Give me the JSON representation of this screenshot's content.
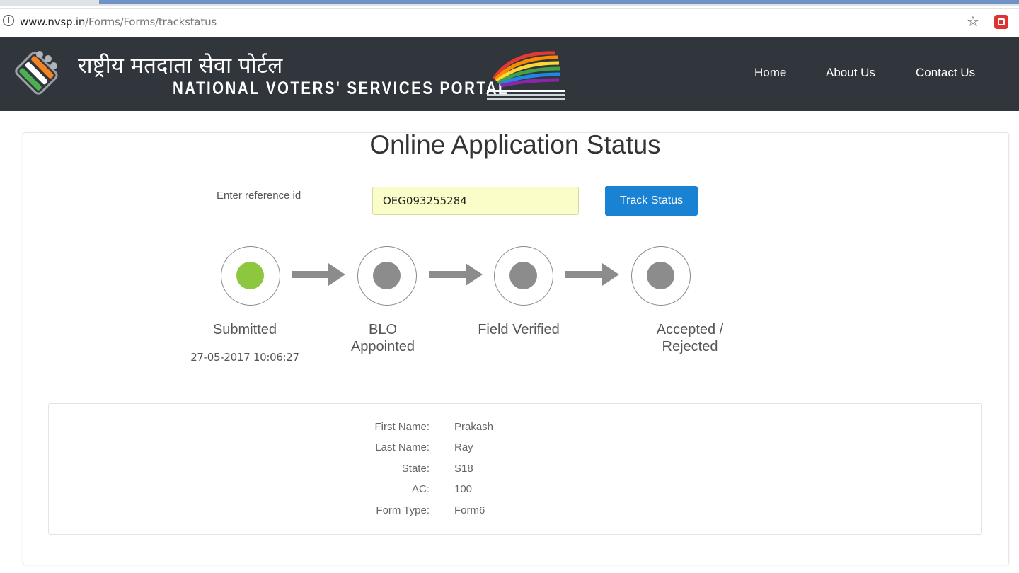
{
  "browser": {
    "url_host": "www.nvsp.in",
    "url_path": "/Forms/Forms/trackstatus"
  },
  "header": {
    "hindi_title": "राष्ट्रीय मतदाता सेवा पोर्टल",
    "english_title": "NATIONAL VOTERS' SERVICES PORTAL",
    "nav": [
      {
        "label": "Home"
      },
      {
        "label": "About Us"
      },
      {
        "label": "Contact Us"
      }
    ]
  },
  "main": {
    "title": "Online Application Status",
    "ref_label": "Enter reference id",
    "ref_value": "OEG093255284",
    "track_button": "Track Status"
  },
  "steps": [
    {
      "label_line1": "Submitted",
      "label_line2": "",
      "date": "27-05-2017 10:06:27",
      "active": true
    },
    {
      "label_line1": "BLO",
      "label_line2": "Appointed",
      "active": false
    },
    {
      "label_line1": "Field Verified",
      "label_line2": "",
      "active": false
    },
    {
      "label_line1": "Accepted /",
      "label_line2": "Rejected",
      "active": false
    }
  ],
  "details": [
    {
      "label": "First Name:",
      "value": "Prakash"
    },
    {
      "label": "Last Name:",
      "value": "Ray"
    },
    {
      "label": "State:",
      "value": "S18"
    },
    {
      "label": "AC:",
      "value": "100"
    },
    {
      "label": "Form Type:",
      "value": "Form6"
    }
  ],
  "colors": {
    "header_bg": "#31363c",
    "button": "#1a82d2",
    "active_step": "#8dc63f",
    "inactive_step": "#8c8c8c",
    "input_bg": "#fbfdc8"
  }
}
